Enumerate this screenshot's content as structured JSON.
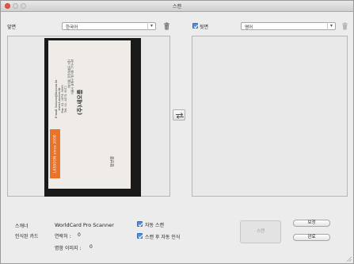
{
  "window": {
    "title": "스캔"
  },
  "front": {
    "label": "앞면",
    "language": "한국어"
  },
  "back": {
    "label": "뒷면",
    "language": "영어"
  },
  "card": {
    "company": "(주)새오름",
    "address_line1": "서울시 송파구 방이동 170-48",
    "address_line2": "(방이동 코리아빌딩 3층)",
    "tel": "Tel. 02. 3474. 9011",
    "fax": "Fax. 02. 3474. 9009",
    "web": "www.Lassoon.kr",
    "email": "E-mail. lassoon@lassoon.kr",
    "name": "정보영",
    "brand": "LASSOON since 2008"
  },
  "info": {
    "scanner_label": "스캐너",
    "scanner_value": "WorldCard Pro Scanner",
    "recognized_label": "인식된 카드",
    "contacts_label": "연락처 :",
    "contacts_value": "0",
    "images_label": "명함 이미지 :",
    "images_value": "0"
  },
  "options": {
    "auto_scan": "자동 스캔",
    "auto_recognize": "스캔 후 자동 인식"
  },
  "buttons": {
    "scan": "스캔",
    "calibrate": "보정",
    "done": "완료"
  },
  "colors": {
    "accent": "#4a8fe0",
    "card_orange": "#e8742c"
  }
}
